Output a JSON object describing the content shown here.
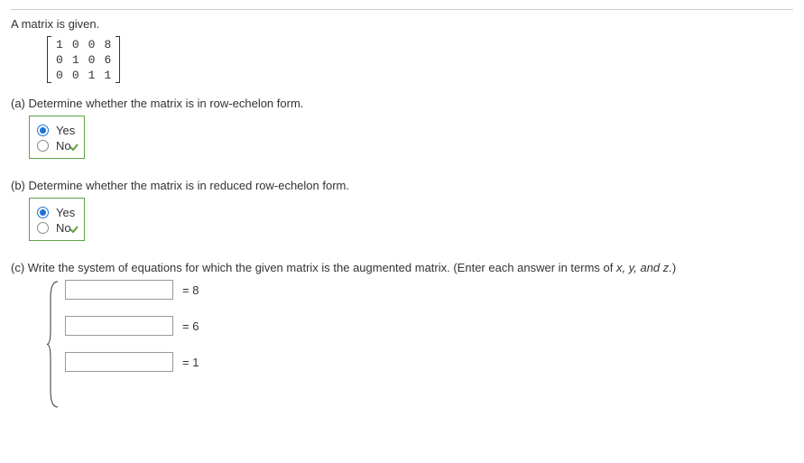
{
  "intro": "A matrix is given.",
  "matrix": {
    "rows": [
      [
        "1",
        "0",
        "0",
        "8"
      ],
      [
        "0",
        "1",
        "0",
        "6"
      ],
      [
        "0",
        "0",
        "1",
        "1"
      ]
    ]
  },
  "part_a": {
    "label": "(a) Determine whether the matrix is in row-echelon form.",
    "options": {
      "yes": "Yes",
      "no": "No"
    },
    "selected": "yes",
    "correct": true
  },
  "part_b": {
    "label": "(b) Determine whether the matrix is in reduced row-echelon form.",
    "options": {
      "yes": "Yes",
      "no": "No"
    },
    "selected": "yes",
    "correct": true
  },
  "part_c": {
    "label_prefix": "(c) Write the system of equations for which the given matrix is the augmented matrix. (Enter each answer in terms of ",
    "vars": "x, y, and z.",
    "label_suffix": ")",
    "equations": [
      {
        "rhs": "= 8"
      },
      {
        "rhs": "= 6"
      },
      {
        "rhs": "= 1"
      }
    ]
  }
}
